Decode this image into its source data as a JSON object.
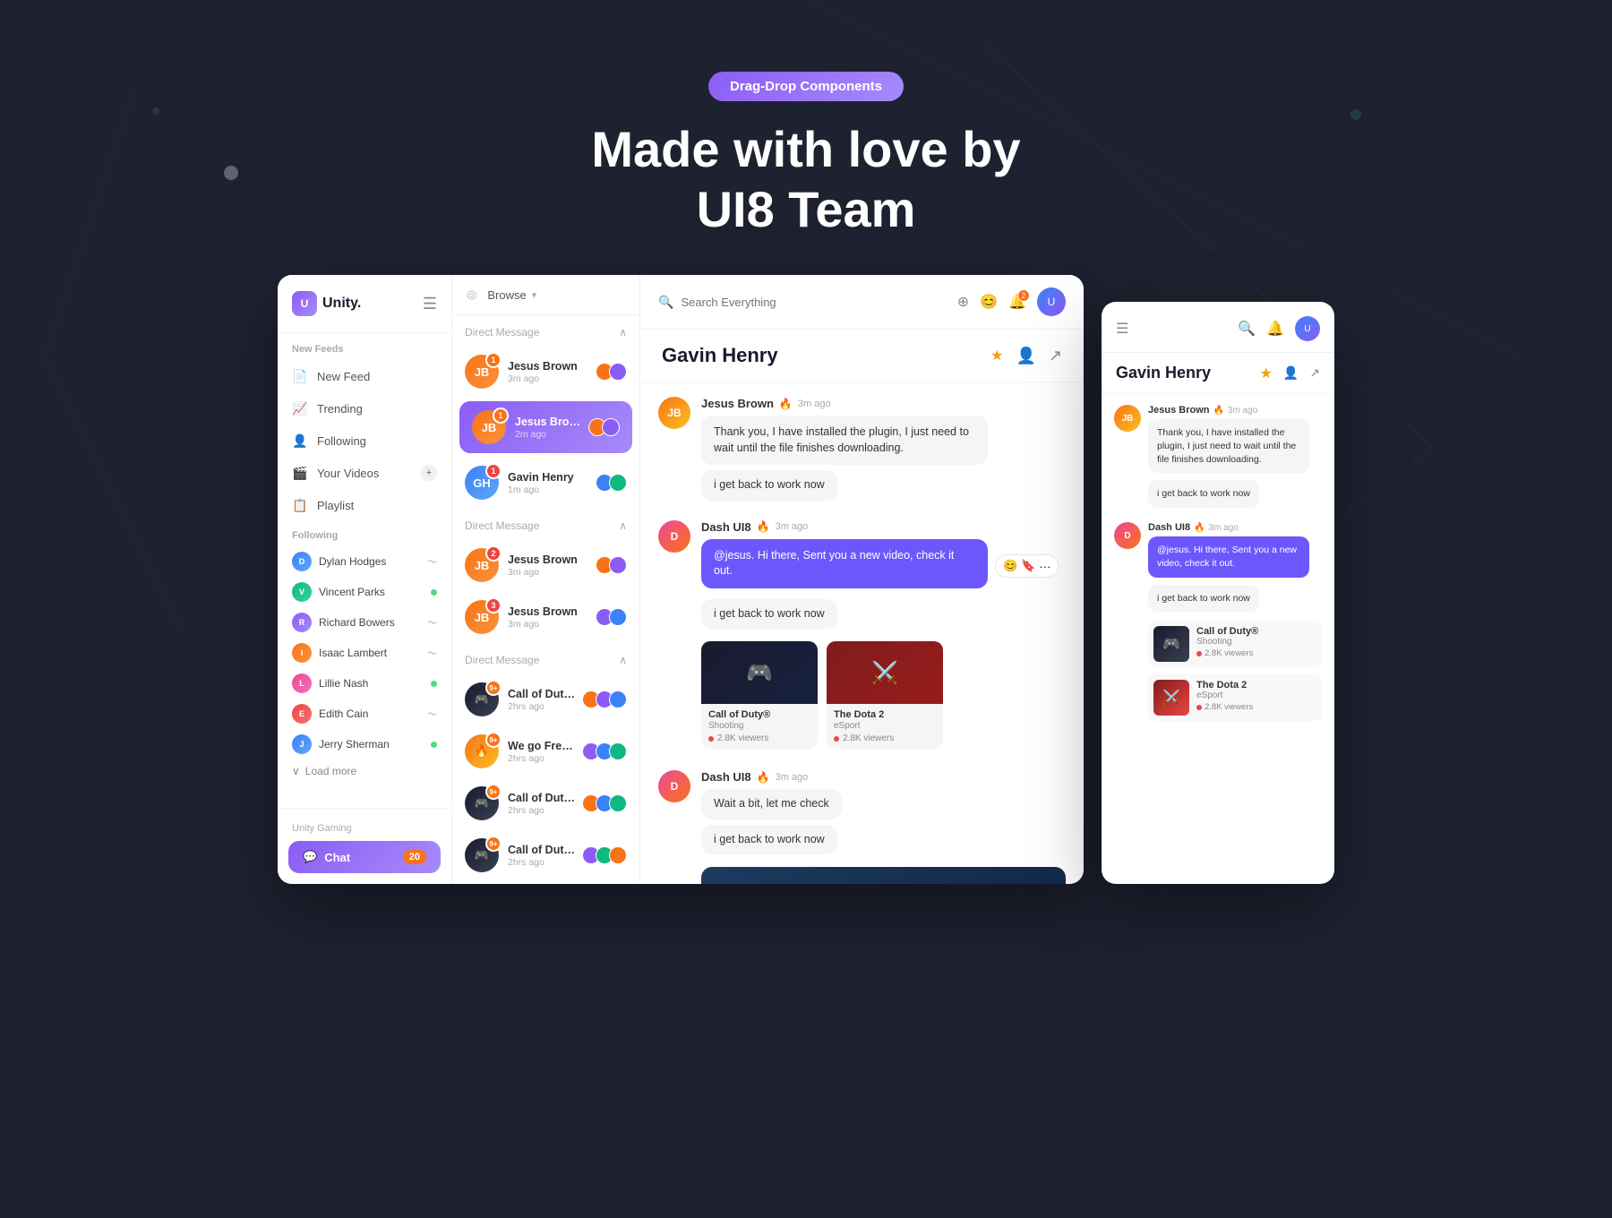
{
  "page": {
    "badge": "Drag-Drop Components",
    "title_line1": "Made with love by",
    "title_line2": "UI8 Team"
  },
  "sidebar": {
    "logo_text": "Unity.",
    "sections": {
      "new_feeds": "New Feeds",
      "following": "Following",
      "unity_gaming": "Unity Gaming"
    },
    "menu_items": [
      {
        "label": "New Feed",
        "icon": "📄"
      },
      {
        "label": "Trending",
        "icon": "📈"
      },
      {
        "label": "Following",
        "icon": "👤"
      },
      {
        "label": "Your Videos",
        "icon": "🎬"
      },
      {
        "label": "Playlist",
        "icon": "📋"
      }
    ],
    "following_users": [
      {
        "name": "Dylan Hodges",
        "status": "wifi"
      },
      {
        "name": "Vincent Parks",
        "status": "online"
      },
      {
        "name": "Richard Bowers",
        "status": "wifi"
      },
      {
        "name": "Isaac Lambert",
        "status": "wifi"
      },
      {
        "name": "Lillie Nash",
        "status": "online"
      },
      {
        "name": "Edith Cain",
        "status": "wifi"
      },
      {
        "name": "Jerry Sherman",
        "status": "online"
      }
    ],
    "load_more": "Load more",
    "chat_label": "Chat",
    "chat_badge": "20"
  },
  "direct_messages_1": {
    "section_title": "Direct Message",
    "items": [
      {
        "name": "Jesus Brown",
        "time": "3m ago",
        "badge": "1",
        "badge_color": "orange"
      },
      {
        "name": "Jesus Brown",
        "time": "2m ago",
        "badge": "1",
        "badge_color": "orange",
        "active": true
      },
      {
        "name": "Gavin Henry",
        "time": "1m ago",
        "badge": "1",
        "badge_color": "red"
      }
    ]
  },
  "direct_messages_2": {
    "section_title": "Direct Message",
    "items": [
      {
        "name": "Jesus Brown",
        "time": "3m ago",
        "badge": "2",
        "badge_color": "red"
      },
      {
        "name": "Jesus Brown",
        "time": "3m ago",
        "badge": "3",
        "badge_color": "red"
      }
    ]
  },
  "direct_messages_3": {
    "section_title": "Direct Message",
    "items": [
      {
        "name": "Call of Duty Group",
        "time": "2hrs ago",
        "badge": "9+",
        "badge_color": "orange"
      },
      {
        "name": "We go FreeFire",
        "time": "2hrs ago",
        "badge": "9+",
        "badge_color": "orange"
      },
      {
        "name": "Call of Duty Group",
        "time": "2hrs ago",
        "badge": "9+",
        "badge_color": "orange"
      },
      {
        "name": "Call of Duty Group",
        "time": "2hrs ago",
        "badge": "9+",
        "badge_color": "orange"
      }
    ]
  },
  "chat": {
    "header_user": "Gavin Henry",
    "search_placeholder": "Search Everything",
    "messages": [
      {
        "sender": "Jesus Brown",
        "time": "3m ago",
        "avatar_type": "jesus",
        "bubbles": [
          "Thank you, I have installed the plugin, I just need to wait until the file finishes downloading.",
          "i get back to work now"
        ]
      },
      {
        "sender": "Dash UI8",
        "time": "3m ago",
        "avatar_type": "dash",
        "bubbles": [
          "@jesus. Hi there, Sent you a new video, check it out."
        ],
        "highlighted": true,
        "sub_bubbles": [
          "i get back to work now"
        ],
        "has_games": true
      },
      {
        "sender": "Dash UI8",
        "time": "3m ago",
        "avatar_type": "dash",
        "bubbles": [
          "Wait a bit, let me check",
          "i get back to work now"
        ]
      }
    ],
    "games": [
      {
        "title": "Call of Duty®",
        "genre": "Shooting",
        "viewers": "2.8K viewers"
      },
      {
        "title": "The Dota 2",
        "genre": "eSport",
        "viewers": "2.8K viewers"
      }
    ]
  },
  "mobile": {
    "header_user": "Gavin Henry",
    "messages": [
      {
        "sender": "Jesus Brown",
        "time": "3m ago",
        "avatar_type": "jesus",
        "bubbles": [
          "Thank you, I have installed the plugin, I just need to wait until the file finishes downloading.",
          "i get back to work now"
        ]
      },
      {
        "sender": "Dash UI8",
        "time": "3m ago",
        "avatar_type": "dash",
        "highlighted_bubble": "@jesus. Hi there, Sent you a new video, check it out.",
        "sub_bubble": "i get back to work now",
        "has_games": true
      }
    ],
    "games": [
      {
        "title": "Call of Duty®",
        "genre": "Shooting",
        "viewers": "2.8K viewers"
      },
      {
        "title": "The Dota 2",
        "genre": "eSport",
        "viewers": "2.8K viewers"
      }
    ]
  }
}
